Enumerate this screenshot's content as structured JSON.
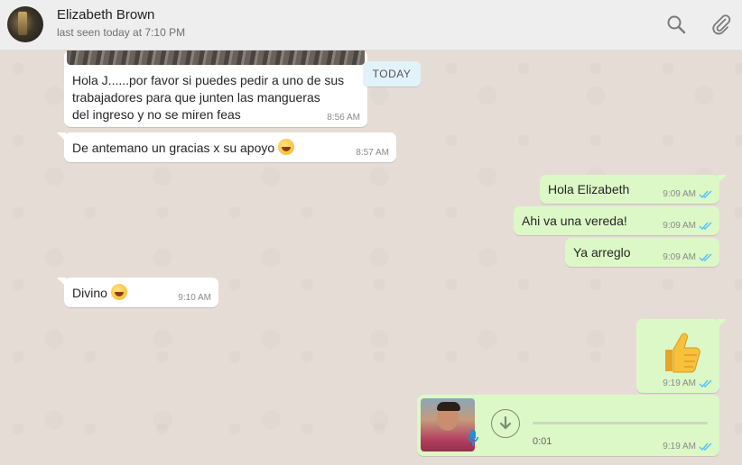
{
  "header": {
    "contact_name": "Elizabeth Brown",
    "last_seen": "last seen today at 7:10 PM",
    "icons": [
      "search-icon",
      "paperclip-icon"
    ]
  },
  "date_divider": "TODAY",
  "messages": [
    {
      "direction": "incoming",
      "lines": [
        "Hola J......por favor si puedes pedir a uno de sus",
        "trabajadores para que junten las mangueras",
        "del ingreso y no se miren feas"
      ],
      "time": "8:56 AM"
    },
    {
      "direction": "incoming",
      "text": "De antemano un gracias x su apoyo",
      "emoji": "winking-face-tongue",
      "time": "8:57 AM"
    },
    {
      "direction": "outgoing",
      "text": "Hola Elizabeth",
      "time": "9:09 AM",
      "status": "read"
    },
    {
      "direction": "outgoing",
      "text": "Ahi va una vereda!",
      "time": "9:09 AM",
      "status": "read"
    },
    {
      "direction": "outgoing",
      "text": "Ya arreglo",
      "time": "9:09 AM",
      "status": "read"
    },
    {
      "direction": "incoming",
      "text": "Divino",
      "emoji": "grinning-face",
      "time": "9:10 AM"
    },
    {
      "direction": "outgoing",
      "emoji": "thumbs-up",
      "time": "9:19 AM",
      "status": "read"
    },
    {
      "direction": "outgoing",
      "type": "voice",
      "duration": "0:01",
      "time": "9:19 AM",
      "status": "read"
    }
  ],
  "colors": {
    "header_bg": "#eeeeee",
    "chat_bg": "#e5ddd5",
    "incoming_bubble": "#ffffff",
    "outgoing_bubble": "#dcf8c6",
    "read_ticks": "#4fc3f7"
  }
}
